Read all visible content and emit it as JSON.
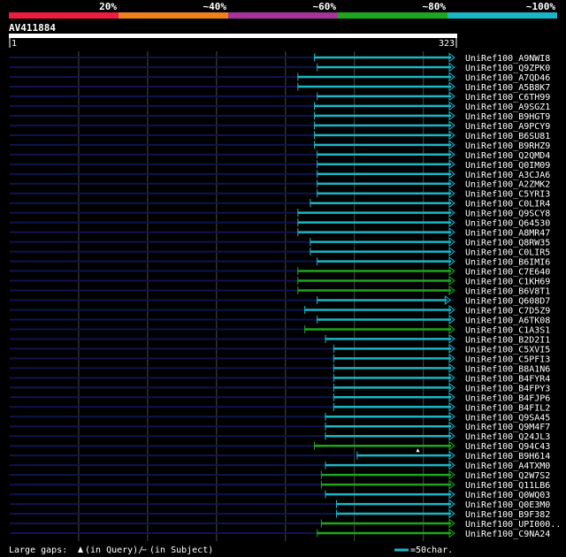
{
  "legend": {
    "labels": [
      "20%",
      "~40%",
      "~60%",
      "~80%",
      "~100%"
    ],
    "colors": [
      "#ee1c3e",
      "#f07f1e",
      "#a5359b",
      "#1ea61e",
      "#1bb6c4"
    ]
  },
  "query": {
    "name": "AV411884",
    "start_label": "1",
    "end_label": "323",
    "length": 323
  },
  "colors": {
    "background": "#000000",
    "gridline": "#4a4a4a",
    "track": "#0d1550",
    "cyan": "#1bb6c4",
    "green": "#1ea61e",
    "ruler": "#ffffff"
  },
  "hits": [
    {
      "name": "UniRef100_A9NWI8",
      "start": 222,
      "end": 323,
      "color": "cyan"
    },
    {
      "name": "UniRef100_Q9ZPK0",
      "start": 224,
      "end": 323,
      "color": "cyan"
    },
    {
      "name": "UniRef100_A7QD46",
      "start": 210,
      "end": 323,
      "color": "cyan"
    },
    {
      "name": "UniRef100_A5B8K7",
      "start": 210,
      "end": 323,
      "color": "cyan"
    },
    {
      "name": "UniRef100_C6TH99",
      "start": 224,
      "end": 323,
      "color": "cyan"
    },
    {
      "name": "UniRef100_A9SGZ1",
      "start": 222,
      "end": 323,
      "color": "cyan"
    },
    {
      "name": "UniRef100_B9HGT9",
      "start": 222,
      "end": 323,
      "color": "cyan"
    },
    {
      "name": "UniRef100_A9PCY9",
      "start": 222,
      "end": 323,
      "color": "cyan"
    },
    {
      "name": "UniRef100_B6SU81",
      "start": 222,
      "end": 323,
      "color": "cyan"
    },
    {
      "name": "UniRef100_B9RHZ9",
      "start": 222,
      "end": 323,
      "color": "cyan"
    },
    {
      "name": "UniRef100_Q2QMD4",
      "start": 224,
      "end": 323,
      "color": "cyan"
    },
    {
      "name": "UniRef100_Q0IM09",
      "start": 224,
      "end": 323,
      "color": "cyan"
    },
    {
      "name": "UniRef100_A3CJA6",
      "start": 224,
      "end": 323,
      "color": "cyan"
    },
    {
      "name": "UniRef100_A2ZMK2",
      "start": 224,
      "end": 323,
      "color": "cyan"
    },
    {
      "name": "UniRef100_C5YRI3",
      "start": 224,
      "end": 323,
      "color": "cyan"
    },
    {
      "name": "UniRef100_C0LIR4",
      "start": 219,
      "end": 323,
      "color": "cyan"
    },
    {
      "name": "UniRef100_Q9SCY8",
      "start": 210,
      "end": 323,
      "color": "cyan"
    },
    {
      "name": "UniRef100_Q64530",
      "start": 210,
      "end": 323,
      "color": "cyan"
    },
    {
      "name": "UniRef100_A8MR47",
      "start": 210,
      "end": 323,
      "color": "cyan"
    },
    {
      "name": "UniRef100_Q8RW35",
      "start": 219,
      "end": 323,
      "color": "cyan"
    },
    {
      "name": "UniRef100_C0LIR5",
      "start": 219,
      "end": 323,
      "color": "cyan"
    },
    {
      "name": "UniRef100_B6IMI6",
      "start": 224,
      "end": 323,
      "color": "cyan"
    },
    {
      "name": "UniRef100_C7E640",
      "start": 210,
      "end": 323,
      "color": "green"
    },
    {
      "name": "UniRef100_C1KH69",
      "start": 210,
      "end": 323,
      "color": "green"
    },
    {
      "name": "UniRef100_B6V8T1",
      "start": 210,
      "end": 323,
      "color": "green"
    },
    {
      "name": "UniRef100_Q608D7",
      "start": 224,
      "end": 320,
      "color": "cyan"
    },
    {
      "name": "UniRef100_C7D5Z9",
      "start": 215,
      "end": 323,
      "color": "cyan"
    },
    {
      "name": "UniRef100_A6TK08",
      "start": 224,
      "end": 323,
      "color": "cyan"
    },
    {
      "name": "UniRef100_C1A3S1",
      "start": 215,
      "end": 323,
      "color": "green"
    },
    {
      "name": "UniRef100_B2D2I1",
      "start": 230,
      "end": 323,
      "color": "cyan"
    },
    {
      "name": "UniRef100_C5XVI5",
      "start": 236,
      "end": 323,
      "color": "cyan"
    },
    {
      "name": "UniRef100_C5PFI3",
      "start": 236,
      "end": 323,
      "color": "cyan"
    },
    {
      "name": "UniRef100_B8A1N6",
      "start": 236,
      "end": 323,
      "color": "cyan"
    },
    {
      "name": "UniRef100_B4FYR4",
      "start": 236,
      "end": 323,
      "color": "cyan"
    },
    {
      "name": "UniRef100_B4FPY3",
      "start": 236,
      "end": 323,
      "color": "cyan"
    },
    {
      "name": "UniRef100_B4FJP6",
      "start": 236,
      "end": 323,
      "color": "cyan"
    },
    {
      "name": "UniRef100_B4FIL2",
      "start": 236,
      "end": 323,
      "color": "cyan"
    },
    {
      "name": "UniRef100_Q9SA45",
      "start": 230,
      "end": 323,
      "color": "cyan"
    },
    {
      "name": "UniRef100_Q9M4F7",
      "start": 230,
      "end": 323,
      "color": "cyan"
    },
    {
      "name": "UniRef100_Q24JL3",
      "start": 230,
      "end": 323,
      "color": "cyan"
    },
    {
      "name": "UniRef100_Q94C43",
      "start": 222,
      "end": 323,
      "color": "green",
      "gap_in_query": 297
    },
    {
      "name": "UniRef100_B9H614",
      "start": 253,
      "end": 323,
      "color": "cyan"
    },
    {
      "name": "UniRef100_A4TXM0",
      "start": 230,
      "end": 323,
      "color": "cyan"
    },
    {
      "name": "UniRef100_Q2W7S2",
      "start": 227,
      "end": 323,
      "color": "green"
    },
    {
      "name": "UniRef100_Q11LB6",
      "start": 227,
      "end": 323,
      "color": "green"
    },
    {
      "name": "UniRef100_Q0WQ03",
      "start": 230,
      "end": 323,
      "color": "cyan"
    },
    {
      "name": "UniRef100_Q0E3M0",
      "start": 238,
      "end": 323,
      "color": "cyan"
    },
    {
      "name": "UniRef100_B9F382",
      "start": 238,
      "end": 323,
      "color": "cyan"
    },
    {
      "name": "UniRef100_UPI000..",
      "start": 227,
      "end": 323,
      "color": "green"
    },
    {
      "name": "UniRef100_C9NA24",
      "start": 224,
      "end": 323,
      "color": "green"
    }
  ],
  "footer": {
    "label": "Large gaps:",
    "query_gap_text": "(in Query)/",
    "subject_gap_symbol": "−",
    "subject_gap_text": "(in Subject)",
    "scale_text": "=50char."
  }
}
